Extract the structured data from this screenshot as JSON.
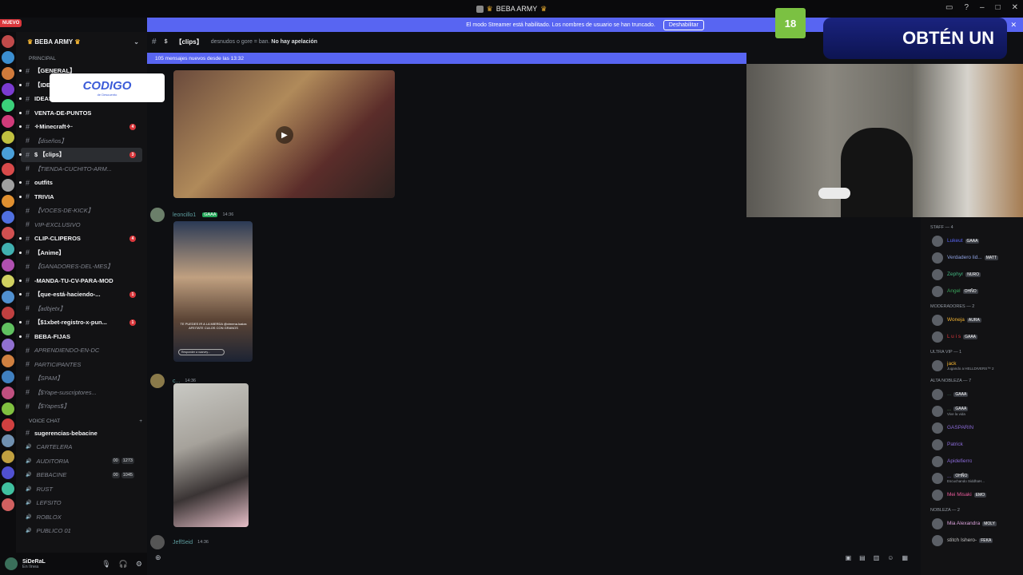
{
  "window": {
    "title": "BEBA ARMY"
  },
  "overlay": {
    "codigo": "CODIGO",
    "codigo_sub": "de Descuento",
    "obten": "OBTÉN UN",
    "badge": "18"
  },
  "banner": {
    "text": "El modo Streamer está habilitado. Los nombres de usuario se han truncado.",
    "button": "Deshabilitar"
  },
  "rail": {
    "nuevo": "NUEVO"
  },
  "guild": {
    "name": "BEBA ARMY"
  },
  "sidebar": {
    "categories": {
      "principal": "PRINCIPAL",
      "voice": "VOICE CHAT"
    },
    "channels": [
      {
        "label": "【GENERAL】",
        "muted": false,
        "unread": ""
      },
      {
        "label": "【IDEAS-PARA-LA-...",
        "muted": false,
        "unread": ""
      },
      {
        "label": "IDEAS-PARA-COMPRAS",
        "muted": false,
        "unread": "1"
      },
      {
        "label": "VENTA-DE-PUNTOS",
        "muted": false,
        "unread": ""
      },
      {
        "label": "✧Minecraft✧·",
        "muted": false,
        "unread": "4"
      },
      {
        "label": "【diseños】",
        "muted": true,
        "unread": ""
      },
      {
        "label": "$ 【clips】",
        "muted": false,
        "unread": "3",
        "active": true
      },
      {
        "label": "【TIENDA-CUCHITO-ARM...",
        "muted": true,
        "unread": ""
      },
      {
        "label": "outfits",
        "muted": false,
        "unread": ""
      },
      {
        "label": "TRIVIA",
        "muted": false,
        "unread": ""
      },
      {
        "label": "【VOCES-DE-KICK】",
        "muted": true,
        "unread": ""
      },
      {
        "label": "VIP-EXCLUSIVO",
        "muted": true,
        "unread": ""
      },
      {
        "label": "CLIP-CLIPEROS",
        "muted": false,
        "unread": "4"
      },
      {
        "label": "【Anime】",
        "muted": false,
        "unread": ""
      },
      {
        "label": "【GANADORES-DEL-MES】",
        "muted": true,
        "unread": ""
      },
      {
        "label": "-MANDA-TU-CV-PARA-MOD",
        "muted": false,
        "unread": ""
      },
      {
        "label": "【que-está-haciendo-...",
        "muted": false,
        "unread": "1"
      },
      {
        "label": "【adbjetx】",
        "muted": true,
        "unread": ""
      },
      {
        "label": "【$1xbet-registro-x-pun...",
        "muted": false,
        "unread": "1"
      },
      {
        "label": "BEBA-FIJAS",
        "muted": false,
        "unread": ""
      },
      {
        "label": "APRENDIENDO-EN-DC",
        "muted": true,
        "unread": ""
      },
      {
        "label": "PARTICIPANTES",
        "muted": true,
        "unread": ""
      },
      {
        "label": "【SPAM】",
        "muted": true,
        "unread": ""
      },
      {
        "label": "【$Yape-suscriptores...",
        "muted": true,
        "unread": ""
      },
      {
        "label": "【$Yapes$】",
        "muted": true,
        "unread": ""
      }
    ],
    "voice": [
      {
        "label": "sugerencias-bebacine",
        "muted": false,
        "counts": []
      },
      {
        "label": "CARTELERA",
        "muted": true,
        "counts": []
      },
      {
        "label": "AUDITORIA",
        "muted": true,
        "counts": [
          "00",
          "1273"
        ]
      },
      {
        "label": "BEBACINE",
        "muted": true,
        "counts": [
          "00",
          "1045"
        ]
      },
      {
        "label": "RUST",
        "muted": true,
        "counts": []
      },
      {
        "label": "LEFSITO",
        "muted": true,
        "counts": []
      },
      {
        "label": "ROBLOX",
        "muted": true,
        "counts": []
      },
      {
        "label": "PUBLICO 01",
        "muted": true,
        "counts": []
      }
    ]
  },
  "user": {
    "name": "SiDeRaL",
    "status": "En línea"
  },
  "chat": {
    "channel": "【clips】",
    "topic": "desnudos o gore = ban.",
    "topic_bold": "No hay apelación",
    "new_messages": "105 mensajes nuevos desde las 13:32",
    "messages": [
      {
        "author": "leoncillo1",
        "tag": "GAAA",
        "time": "14:36",
        "caption": "TE PUEDES IR A LA MIERDA @ximena.loaiza AFEITATE CULOS CON GRANOS",
        "reply": "Responder a xcarvey..."
      },
      {
        "author": "c...",
        "tag": "",
        "time": "14:36"
      },
      {
        "author": "JeffSeid",
        "tag": "",
        "time": "14:36"
      }
    ]
  },
  "members": {
    "groups": [
      {
        "title": "STAFF — 4",
        "items": [
          {
            "name": "Lukeut",
            "tag": "GAAA",
            "color": "#5865f2",
            "sub": ""
          },
          {
            "name": "Verdadero lid...",
            "tag": "MATT",
            "color": "#8ea1e1",
            "sub": ""
          },
          {
            "name": "Zephyr",
            "tag": "NURO",
            "color": "#43b581",
            "sub": ""
          },
          {
            "name": "Angel",
            "tag": "OHÑO",
            "color": "#3ba55c",
            "sub": ""
          }
        ]
      },
      {
        "title": "MODERADORES — 2",
        "items": [
          {
            "name": "Woneja",
            "tag": "AURA",
            "color": "#f0b232",
            "sub": ""
          },
          {
            "name": "L u i s",
            "tag": "GAAA",
            "color": "#da373c",
            "sub": ""
          }
        ]
      },
      {
        "title": "ULTRA VIP — 1",
        "items": [
          {
            "name": "jack",
            "tag": "",
            "color": "#f0b232",
            "sub": "Jugando a HELLDIVERS™ 2"
          }
        ]
      },
      {
        "title": "ALTA NOBLEZA — 7",
        "items": [
          {
            "name": "...",
            "tag": "GAAA",
            "color": "#3a6f5a",
            "sub": ""
          },
          {
            "name": "...",
            "tag": "GAAA",
            "color": "#5f8f5f",
            "sub": "Vive la vida"
          },
          {
            "name": "GASPARIN",
            "tag": "",
            "color": "#8b6bd8",
            "sub": ""
          },
          {
            "name": "Patrick",
            "tag": "",
            "color": "#8b6bd8",
            "sub": ""
          },
          {
            "name": "Apidefierro",
            "tag": "",
            "color": "#8b6bd8",
            "sub": ""
          },
          {
            "name": "...",
            "tag": "OHÑO",
            "color": "#8b6bd8",
            "sub": "Escuchando SiddhaH..."
          },
          {
            "name": "Mei Misaki",
            "tag": "EMO",
            "color": "#e85b9b",
            "sub": ""
          }
        ]
      },
      {
        "title": "NOBLEZA — 2",
        "items": [
          {
            "name": "Mia Alexandra",
            "tag": "MOLY",
            "color": "#d8a0d8",
            "sub": ""
          },
          {
            "name": "stitch Ishero-",
            "tag": "FEKA",
            "color": "#c0c0c0",
            "sub": ""
          }
        ]
      }
    ]
  }
}
